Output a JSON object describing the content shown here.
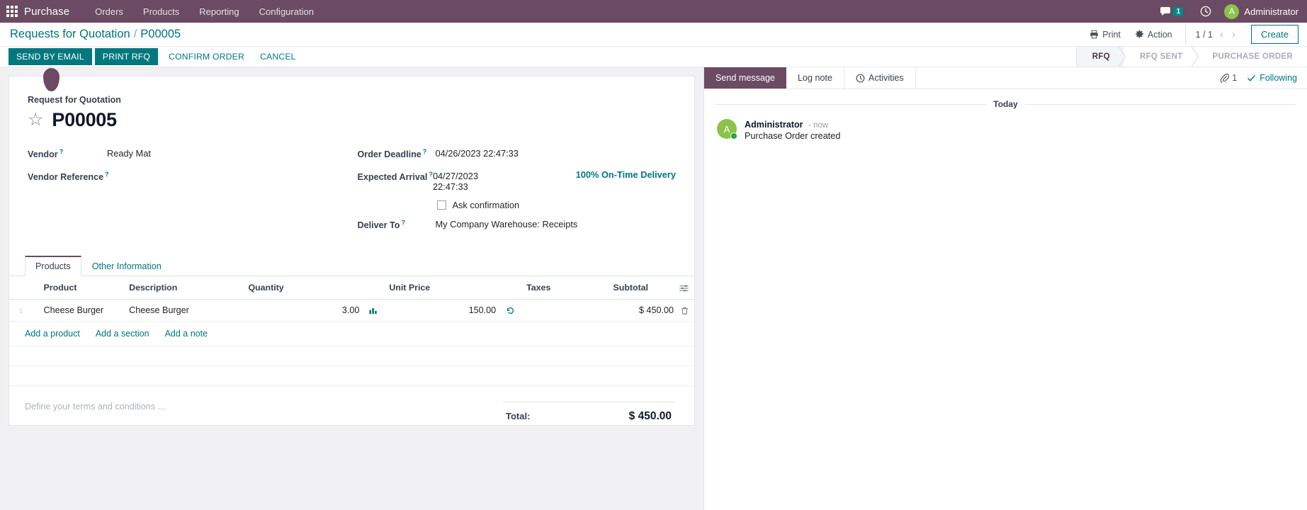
{
  "navbar": {
    "apps_icon": "apps-grid-icon",
    "brand": "Purchase",
    "menus": [
      "Orders",
      "Products",
      "Reporting",
      "Configuration"
    ],
    "messages_icon": "messages-icon",
    "messages_count": "1",
    "activities_icon": "clock-icon",
    "user_initial": "A",
    "user_name": "Administrator",
    "bg_color": "#6b4a63",
    "accent_badge_color": "#00878a"
  },
  "control_panel": {
    "breadcrumb_root": "Requests for Quotation",
    "breadcrumb_sep": "/",
    "breadcrumb_current": "P00005",
    "print_label": "Print",
    "print_icon": "printer-icon",
    "action_label": "Action",
    "action_icon": "gear-icon",
    "pager": "1 / 1",
    "prev_icon": "chevron-left-icon",
    "next_icon": "chevron-right-icon",
    "create_label": "Create"
  },
  "statusbar": {
    "buttons": [
      {
        "label": "SEND BY EMAIL",
        "style": "primary"
      },
      {
        "label": "PRINT RFQ",
        "style": "primary"
      },
      {
        "label": "CONFIRM ORDER",
        "style": "secondary"
      },
      {
        "label": "CANCEL",
        "style": "secondary"
      }
    ],
    "stages": [
      {
        "label": "RFQ",
        "active": true
      },
      {
        "label": "RFQ SENT",
        "active": false
      },
      {
        "label": "PURCHASE ORDER",
        "active": false
      }
    ]
  },
  "form": {
    "record_label": "Request for Quotation",
    "star_icon": "star-outline-icon",
    "title": "P00005",
    "left_fields": [
      {
        "label": "Vendor",
        "help": "?",
        "value": "Ready Mat"
      },
      {
        "label": "Vendor Reference",
        "help": "?",
        "value": ""
      }
    ],
    "right_fields": [
      {
        "label": "Order Deadline",
        "help": "?",
        "value": "04/26/2023 22:47:33"
      },
      {
        "label": "Expected Arrival",
        "help": "?",
        "value": "04/27/2023 22:47:33"
      }
    ],
    "ontime_badge": "100% On-Time Delivery",
    "ask_confirmation_label": "Ask confirmation",
    "ask_confirmation_checked": false,
    "deliver_to_label": "Deliver To",
    "deliver_to_help": "?",
    "deliver_to_value": "My Company Warehouse: Receipts"
  },
  "notebook": {
    "tabs": [
      {
        "label": "Products",
        "active": true
      },
      {
        "label": "Other Information",
        "active": false
      }
    ],
    "columns": [
      "Product",
      "Description",
      "Quantity",
      "Unit Price",
      "Taxes",
      "Subtotal"
    ],
    "options_icon": "column-options-icon",
    "rows": [
      {
        "handle_icon": "drag-handle-icon",
        "product": "Cheese Burger",
        "description": "Cheese Burger",
        "quantity": "3.00",
        "qty_icon": "forecast-report-icon",
        "unit_price": "150.00",
        "price_icon": "price-history-icon",
        "taxes": "",
        "subtotal": "$ 450.00",
        "delete_icon": "trash-icon"
      }
    ],
    "add_links": [
      "Add a product",
      "Add a section",
      "Add a note"
    ]
  },
  "footer": {
    "terms_placeholder": "Define your terms and conditions ...",
    "total_label": "Total:",
    "total_value": "$ 450.00"
  },
  "chatter": {
    "send_message": "Send message",
    "log_note": "Log note",
    "activities": "Activities",
    "activities_icon": "clock-icon",
    "attachment_icon": "paperclip-icon",
    "attachment_count": "1",
    "following_icon": "check-icon",
    "following_label": "Following",
    "day_separator": "Today",
    "messages": [
      {
        "avatar_initial": "A",
        "author": "Administrator",
        "time": "- now",
        "body": "Purchase Order created"
      }
    ]
  }
}
